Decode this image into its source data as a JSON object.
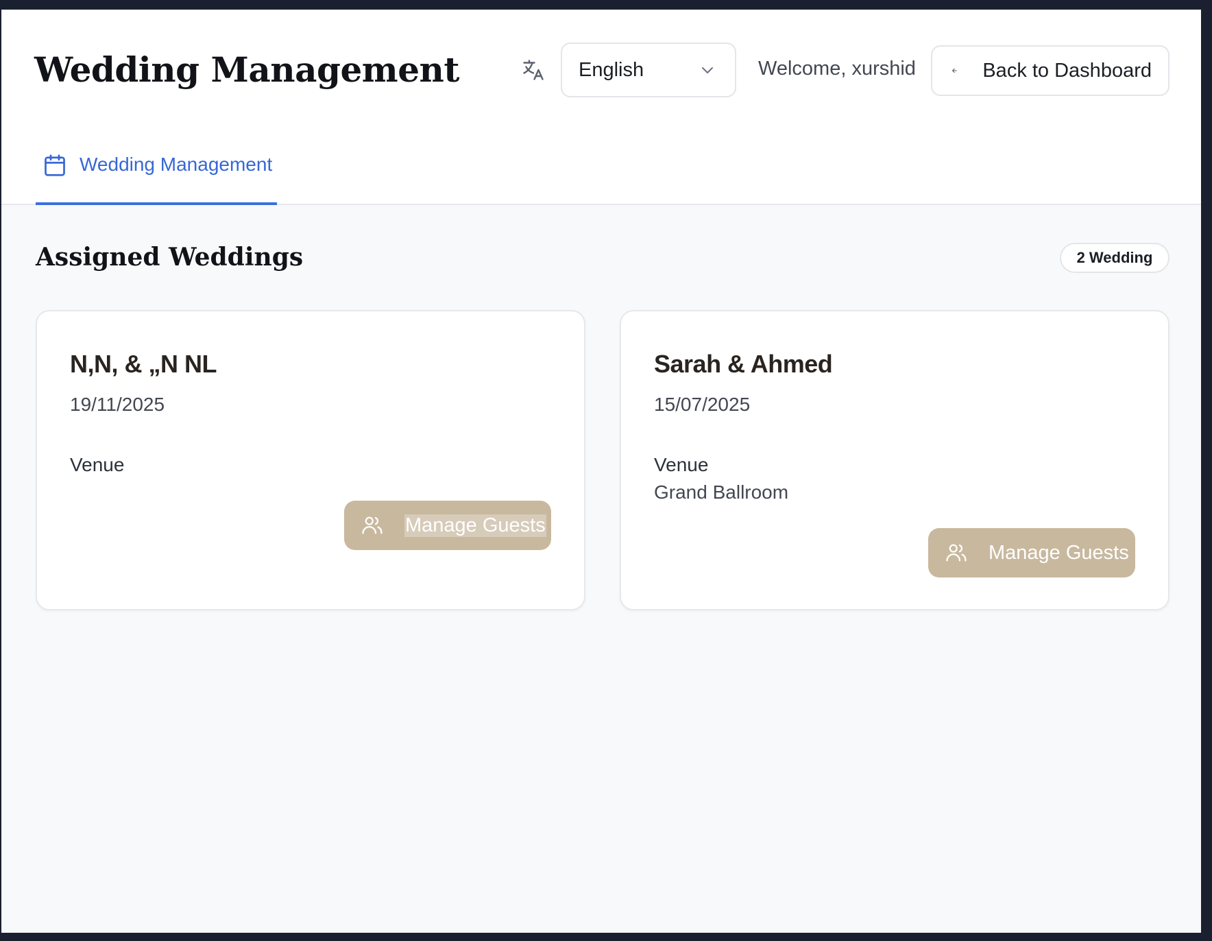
{
  "header": {
    "title": "Wedding Management",
    "translate_icon": "translate-icon",
    "language": {
      "selected": "English",
      "icon": "chevron-down-icon"
    },
    "welcome_text": "Welcome, xurshid",
    "back_button": {
      "label": "Back to Dashboard",
      "icon": "arrow-left-icon"
    }
  },
  "tabs": [
    {
      "label": "Wedding Management",
      "icon": "calendar-icon",
      "active": true,
      "color": "#3767d6"
    }
  ],
  "section": {
    "title": "Assigned Weddings",
    "count_badge": "2 Wedding"
  },
  "weddings": [
    {
      "couple": "N,N, & „N NL",
      "date": "19/11/2025",
      "venue_label": "Venue",
      "venue": "",
      "action_label": "Manage Guests",
      "action_icon": "users-icon"
    },
    {
      "couple": "Sarah & Ahmed",
      "date": "15/07/2025",
      "venue_label": "Venue",
      "venue": "Grand Ballroom",
      "action_label": "Manage Guests",
      "action_icon": "users-icon"
    }
  ],
  "colors": {
    "accent": "#3b6fe0",
    "button": "#c8b89e",
    "background": "#f8f9fb"
  }
}
